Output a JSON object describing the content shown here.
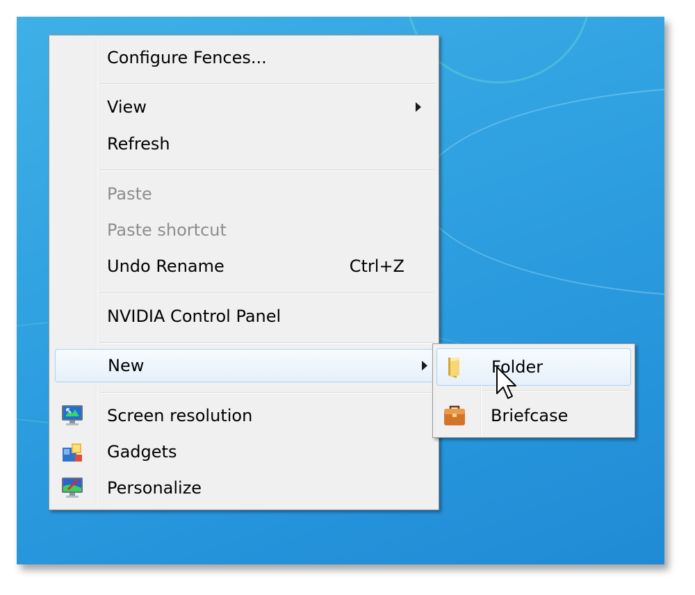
{
  "context_menu": {
    "items": [
      {
        "label": "Configure Fences...",
        "shortcut": "",
        "disabled": false
      },
      {
        "label": "View",
        "shortcut": "",
        "disabled": false,
        "submenu": true
      },
      {
        "label": "Refresh",
        "shortcut": "",
        "disabled": false
      },
      {
        "label": "Paste",
        "shortcut": "",
        "disabled": true
      },
      {
        "label": "Paste shortcut",
        "shortcut": "",
        "disabled": true
      },
      {
        "label": "Undo Rename",
        "shortcut": "Ctrl+Z",
        "disabled": false
      },
      {
        "label": "NVIDIA Control Panel",
        "shortcut": "",
        "disabled": false
      },
      {
        "label": "New",
        "shortcut": "",
        "disabled": false,
        "submenu": true,
        "highlighted": true
      },
      {
        "label": "Screen resolution",
        "icon": "screen-resolution-icon",
        "disabled": false
      },
      {
        "label": "Gadgets",
        "icon": "gadgets-icon",
        "disabled": false
      },
      {
        "label": "Personalize",
        "icon": "personalize-icon",
        "disabled": false
      }
    ]
  },
  "new_submenu": {
    "items": [
      {
        "label": "Folder",
        "icon": "folder-icon",
        "highlighted": true
      },
      {
        "label": "Briefcase",
        "icon": "briefcase-icon"
      }
    ]
  },
  "colors": {
    "menu_bg": "#f0f0f0",
    "highlight_border": "#a8d1f2",
    "desktop_blue": "#2e9fe0"
  }
}
